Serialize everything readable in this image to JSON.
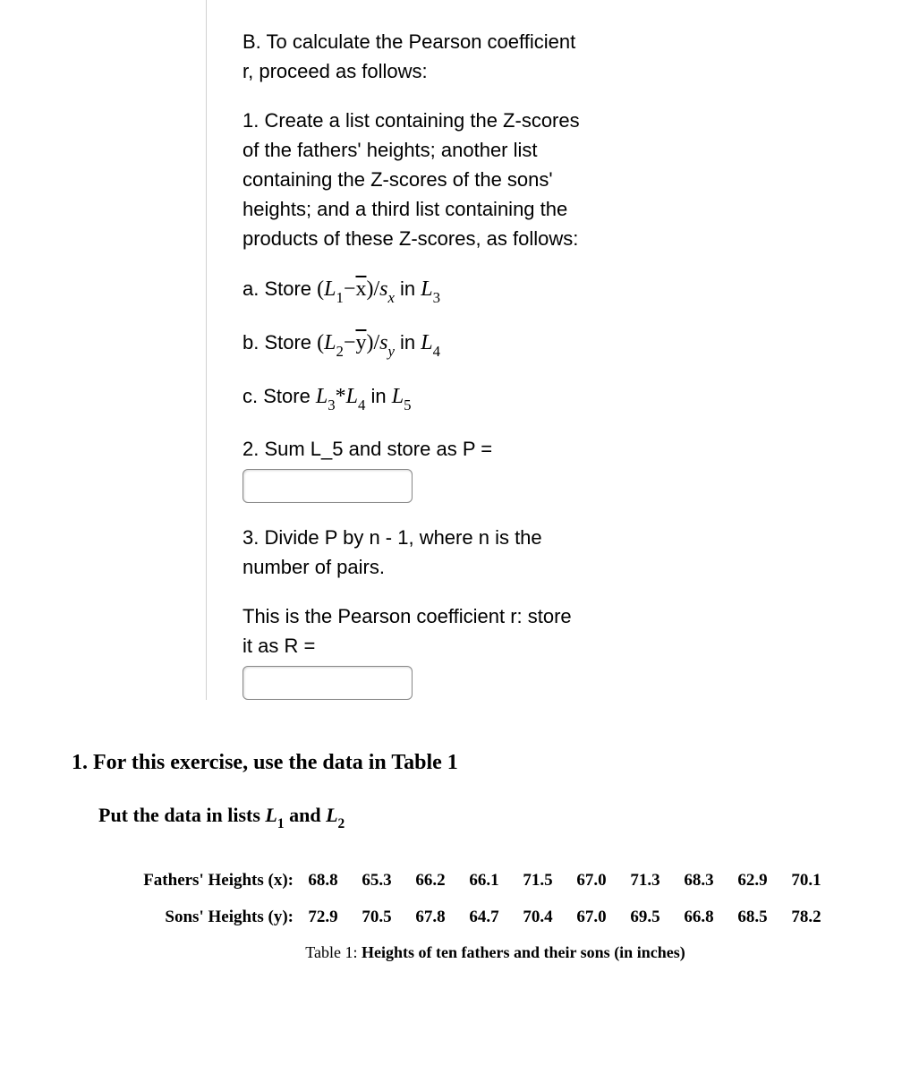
{
  "section_b": {
    "intro": "B. To calculate the Pearson coefficient r, proceed as follows:",
    "step1": "1. Create a list containing the Z-scores of the fathers' heights; another list containing the Z-scores of the sons' heights; and a third list containing the products of these Z-scores, as follows:",
    "step1a_prefix": "a. Store ",
    "step1a_in": " in ",
    "step1b_prefix": "b. Store ",
    "step1b_in": " in ",
    "step1c_prefix": "c. Store ",
    "step1c_in": " in ",
    "step2": "2. Sum L_5 and store as P =",
    "step3": "3. Divide P by n - 1, where n is the number of pairs.",
    "pearson_text": "This is the Pearson coefficient r: store it as R ="
  },
  "exercise": {
    "title": "1. For this exercise, use the data in Table 1",
    "subtitle_prefix": "Put the data in lists ",
    "subtitle_and": " and ",
    "fathers_label": "Fathers' Heights (x):",
    "sons_label": "Sons' Heights (y):",
    "fathers_values": [
      "68.8",
      "65.3",
      "66.2",
      "66.1",
      "71.5",
      "67.0",
      "71.3",
      "68.3",
      "62.9",
      "70.1"
    ],
    "sons_values": [
      "72.9",
      "70.5",
      "67.8",
      "64.7",
      "70.4",
      "67.0",
      "69.5",
      "66.8",
      "68.5",
      "78.2"
    ],
    "table_caption_prefix": "Table 1: ",
    "table_caption": "Heights of ten fathers and their sons (in inches)"
  },
  "inputs": {
    "p_value": "",
    "r_value": ""
  }
}
